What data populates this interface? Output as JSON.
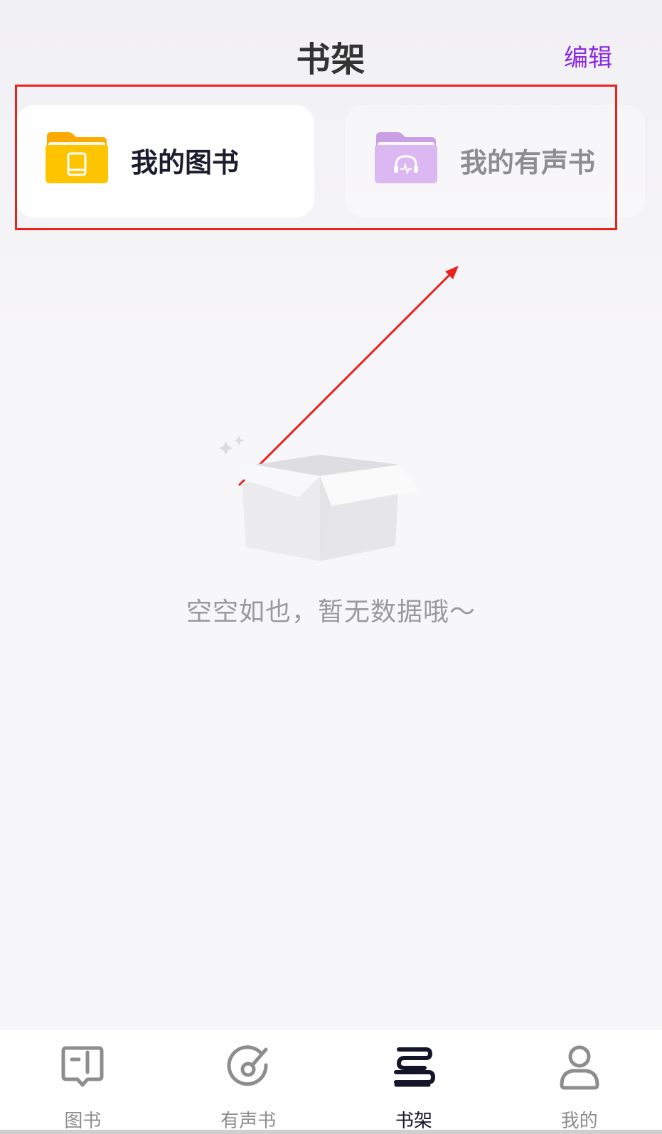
{
  "header": {
    "title": "书架",
    "edit_label": "编辑"
  },
  "categories": [
    {
      "label": "我的图书",
      "icon": "book-folder-icon",
      "active": true
    },
    {
      "label": "我的有声书",
      "icon": "audiobook-folder-icon",
      "active": false
    }
  ],
  "empty_state": {
    "message": "空空如也，暂无数据哦～",
    "icon": "empty-box-icon"
  },
  "tab_bar": {
    "tabs": [
      {
        "label": "图书",
        "icon": "book-icon",
        "active": false
      },
      {
        "label": "有声书",
        "icon": "disc-icon",
        "active": false
      },
      {
        "label": "书架",
        "icon": "bookshelf-icon",
        "active": true
      },
      {
        "label": "我的",
        "icon": "user-icon",
        "active": false
      }
    ]
  },
  "colors": {
    "accent": "#8a2be2",
    "book_folder": "#ffc400",
    "audio_folder": "#d8b4f0",
    "annotation": "#e8231f",
    "active_tab": "#15152a",
    "inactive_tab": "#8d8d8d"
  }
}
